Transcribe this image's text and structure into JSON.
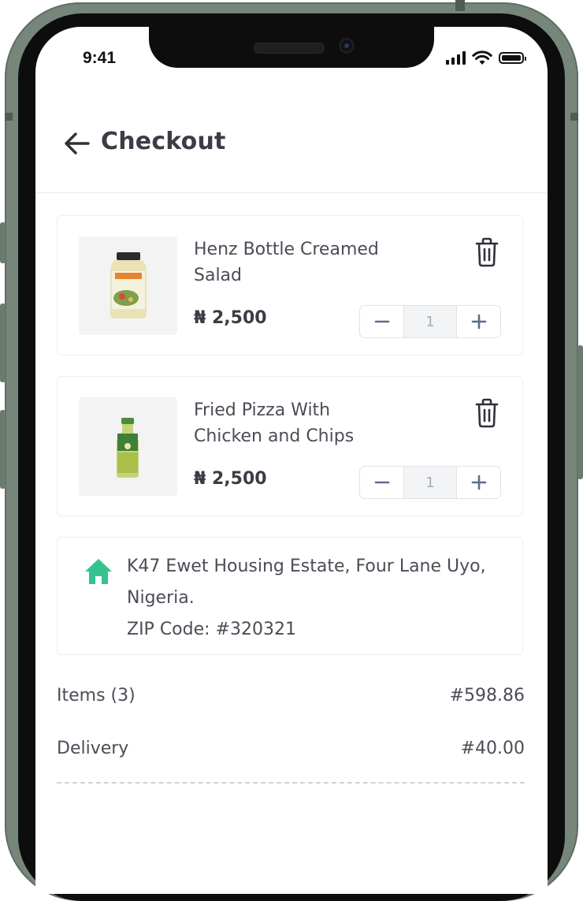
{
  "status_bar": {
    "time": "9:41"
  },
  "header": {
    "title": "Checkout"
  },
  "cart": {
    "items": [
      {
        "name": "Henz Bottle Creamed Salad",
        "price": "₦ 2,500",
        "quantity": "1"
      },
      {
        "name": "Fried Pizza With Chicken and Chips",
        "price": "₦ 2,500",
        "quantity": "1"
      }
    ]
  },
  "address": {
    "line1": "K47 Ewet Housing Estate, Four Lane Uyo,",
    "line2": "Nigeria.",
    "zip": "ZIP Code: #320321"
  },
  "summary": {
    "items_label": "Items (3)",
    "items_value": "#598.86",
    "delivery_label": "Delivery",
    "delivery_value": "#40.00"
  },
  "colors": {
    "frame": "#76867a",
    "home_icon": "#34c38f",
    "text": "#4a4d55"
  }
}
